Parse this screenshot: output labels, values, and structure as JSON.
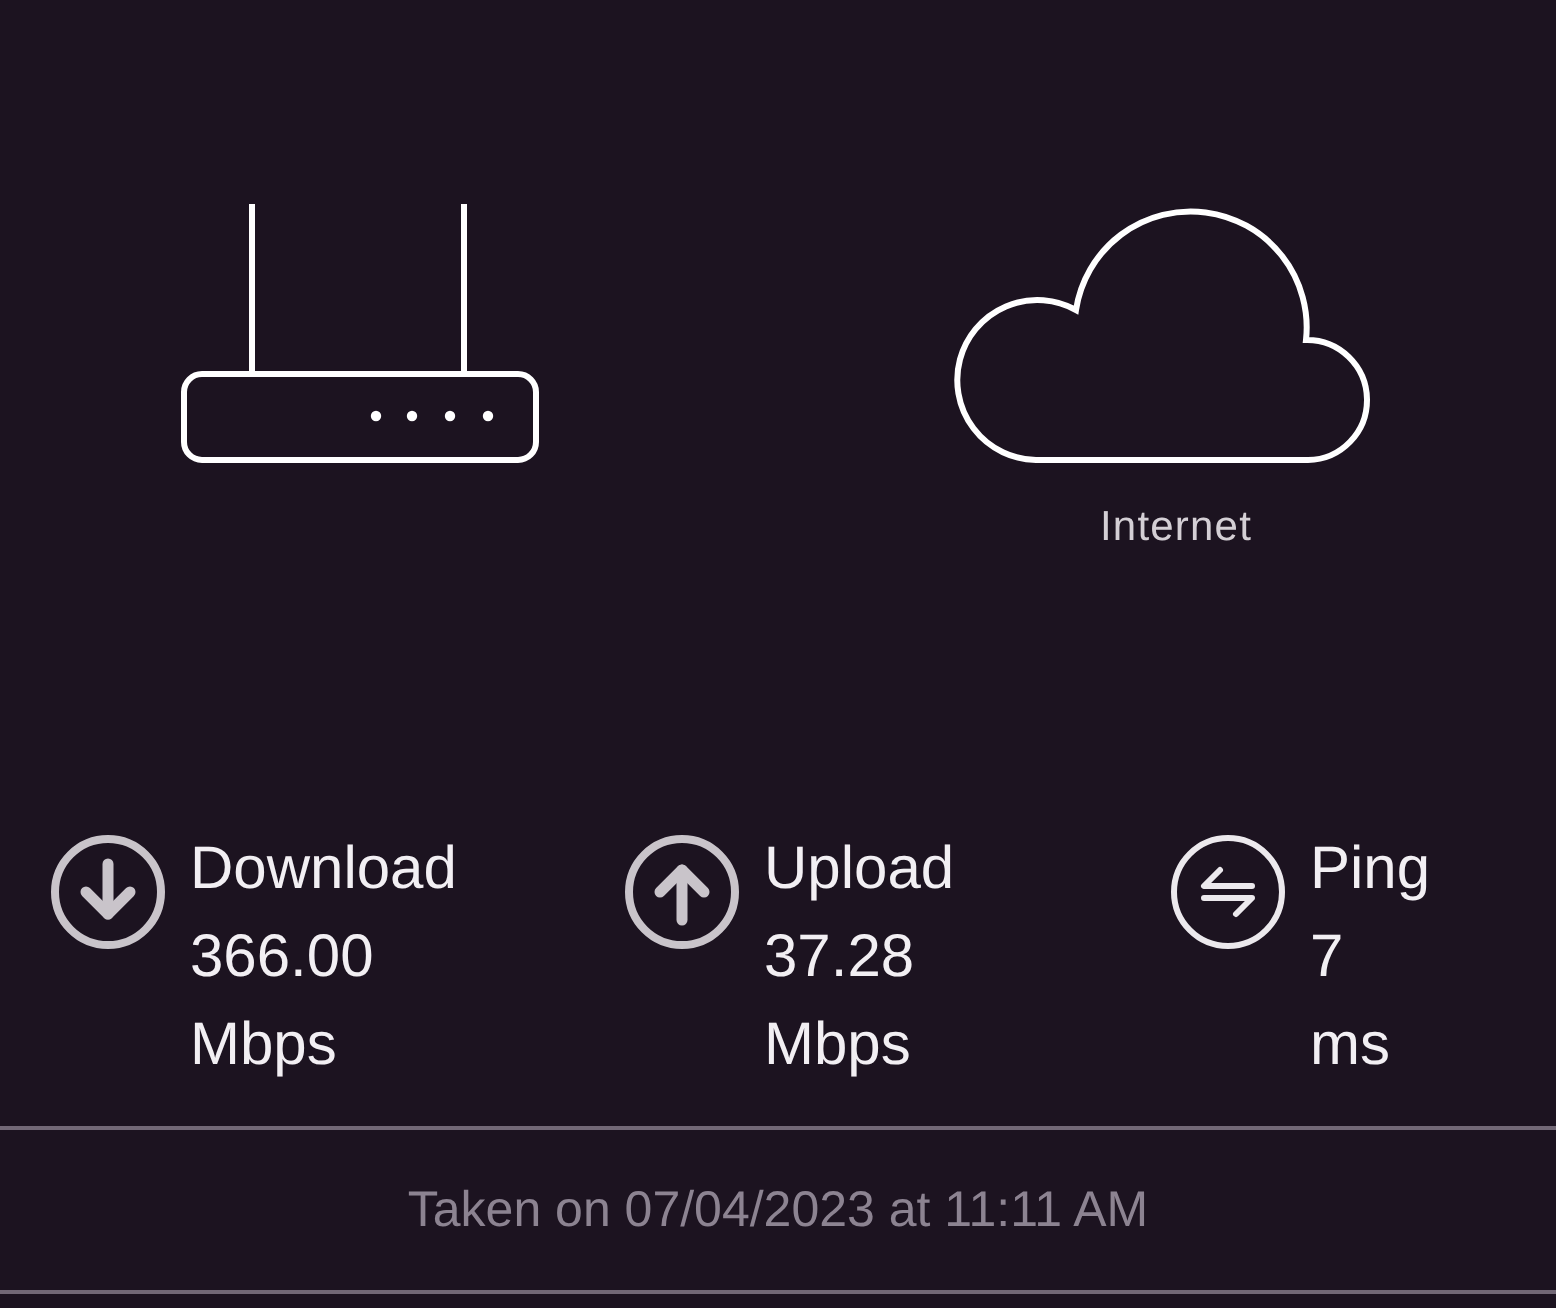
{
  "devices": [
    {
      "kind": "router"
    },
    {
      "kind": "cloud",
      "label": "Internet"
    }
  ],
  "metrics": [
    {
      "kind": "download",
      "label": "Download",
      "value": "366.00",
      "unit": "Mbps"
    },
    {
      "kind": "upload",
      "label": "Upload",
      "value": "37.28",
      "unit": "Mbps"
    },
    {
      "kind": "ping",
      "label": "Ping",
      "value": "7",
      "unit": "ms"
    }
  ],
  "footer": {
    "text": "Taken on 07/04/2023 at 11:11 AM"
  }
}
